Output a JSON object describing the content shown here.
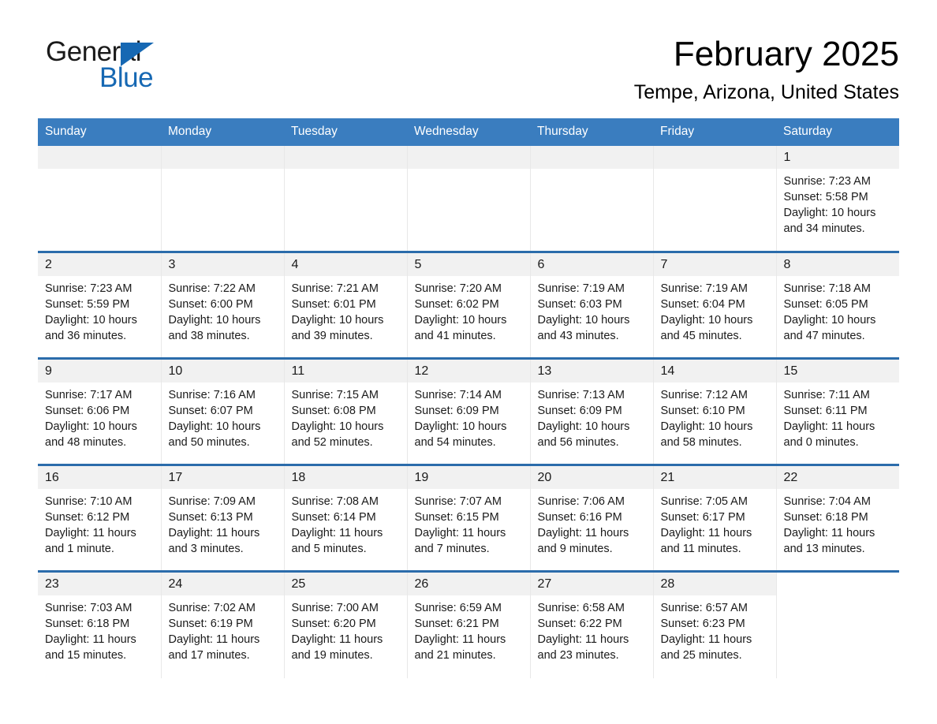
{
  "brand": {
    "name_part1": "General",
    "name_part2": "Blue",
    "accent_color": "#1668b3"
  },
  "header": {
    "title": "February 2025",
    "location": "Tempe, Arizona, United States"
  },
  "theme": {
    "header_blue": "#3a7dbf",
    "row_border_blue": "#2b6cab",
    "daynum_band": "#f1f1f1"
  },
  "weekdays": [
    "Sunday",
    "Monday",
    "Tuesday",
    "Wednesday",
    "Thursday",
    "Friday",
    "Saturday"
  ],
  "weeks": [
    [
      {
        "day": "",
        "lines": []
      },
      {
        "day": "",
        "lines": []
      },
      {
        "day": "",
        "lines": []
      },
      {
        "day": "",
        "lines": []
      },
      {
        "day": "",
        "lines": []
      },
      {
        "day": "",
        "lines": []
      },
      {
        "day": "1",
        "lines": [
          "Sunrise: 7:23 AM",
          "Sunset: 5:58 PM",
          "Daylight: 10 hours",
          "and 34 minutes."
        ]
      }
    ],
    [
      {
        "day": "2",
        "lines": [
          "Sunrise: 7:23 AM",
          "Sunset: 5:59 PM",
          "Daylight: 10 hours",
          "and 36 minutes."
        ]
      },
      {
        "day": "3",
        "lines": [
          "Sunrise: 7:22 AM",
          "Sunset: 6:00 PM",
          "Daylight: 10 hours",
          "and 38 minutes."
        ]
      },
      {
        "day": "4",
        "lines": [
          "Sunrise: 7:21 AM",
          "Sunset: 6:01 PM",
          "Daylight: 10 hours",
          "and 39 minutes."
        ]
      },
      {
        "day": "5",
        "lines": [
          "Sunrise: 7:20 AM",
          "Sunset: 6:02 PM",
          "Daylight: 10 hours",
          "and 41 minutes."
        ]
      },
      {
        "day": "6",
        "lines": [
          "Sunrise: 7:19 AM",
          "Sunset: 6:03 PM",
          "Daylight: 10 hours",
          "and 43 minutes."
        ]
      },
      {
        "day": "7",
        "lines": [
          "Sunrise: 7:19 AM",
          "Sunset: 6:04 PM",
          "Daylight: 10 hours",
          "and 45 minutes."
        ]
      },
      {
        "day": "8",
        "lines": [
          "Sunrise: 7:18 AM",
          "Sunset: 6:05 PM",
          "Daylight: 10 hours",
          "and 47 minutes."
        ]
      }
    ],
    [
      {
        "day": "9",
        "lines": [
          "Sunrise: 7:17 AM",
          "Sunset: 6:06 PM",
          "Daylight: 10 hours",
          "and 48 minutes."
        ]
      },
      {
        "day": "10",
        "lines": [
          "Sunrise: 7:16 AM",
          "Sunset: 6:07 PM",
          "Daylight: 10 hours",
          "and 50 minutes."
        ]
      },
      {
        "day": "11",
        "lines": [
          "Sunrise: 7:15 AM",
          "Sunset: 6:08 PM",
          "Daylight: 10 hours",
          "and 52 minutes."
        ]
      },
      {
        "day": "12",
        "lines": [
          "Sunrise: 7:14 AM",
          "Sunset: 6:09 PM",
          "Daylight: 10 hours",
          "and 54 minutes."
        ]
      },
      {
        "day": "13",
        "lines": [
          "Sunrise: 7:13 AM",
          "Sunset: 6:09 PM",
          "Daylight: 10 hours",
          "and 56 minutes."
        ]
      },
      {
        "day": "14",
        "lines": [
          "Sunrise: 7:12 AM",
          "Sunset: 6:10 PM",
          "Daylight: 10 hours",
          "and 58 minutes."
        ]
      },
      {
        "day": "15",
        "lines": [
          "Sunrise: 7:11 AM",
          "Sunset: 6:11 PM",
          "Daylight: 11 hours",
          "and 0 minutes."
        ]
      }
    ],
    [
      {
        "day": "16",
        "lines": [
          "Sunrise: 7:10 AM",
          "Sunset: 6:12 PM",
          "Daylight: 11 hours",
          "and 1 minute."
        ]
      },
      {
        "day": "17",
        "lines": [
          "Sunrise: 7:09 AM",
          "Sunset: 6:13 PM",
          "Daylight: 11 hours",
          "and 3 minutes."
        ]
      },
      {
        "day": "18",
        "lines": [
          "Sunrise: 7:08 AM",
          "Sunset: 6:14 PM",
          "Daylight: 11 hours",
          "and 5 minutes."
        ]
      },
      {
        "day": "19",
        "lines": [
          "Sunrise: 7:07 AM",
          "Sunset: 6:15 PM",
          "Daylight: 11 hours",
          "and 7 minutes."
        ]
      },
      {
        "day": "20",
        "lines": [
          "Sunrise: 7:06 AM",
          "Sunset: 6:16 PM",
          "Daylight: 11 hours",
          "and 9 minutes."
        ]
      },
      {
        "day": "21",
        "lines": [
          "Sunrise: 7:05 AM",
          "Sunset: 6:17 PM",
          "Daylight: 11 hours",
          "and 11 minutes."
        ]
      },
      {
        "day": "22",
        "lines": [
          "Sunrise: 7:04 AM",
          "Sunset: 6:18 PM",
          "Daylight: 11 hours",
          "and 13 minutes."
        ]
      }
    ],
    [
      {
        "day": "23",
        "lines": [
          "Sunrise: 7:03 AM",
          "Sunset: 6:18 PM",
          "Daylight: 11 hours",
          "and 15 minutes."
        ]
      },
      {
        "day": "24",
        "lines": [
          "Sunrise: 7:02 AM",
          "Sunset: 6:19 PM",
          "Daylight: 11 hours",
          "and 17 minutes."
        ]
      },
      {
        "day": "25",
        "lines": [
          "Sunrise: 7:00 AM",
          "Sunset: 6:20 PM",
          "Daylight: 11 hours",
          "and 19 minutes."
        ]
      },
      {
        "day": "26",
        "lines": [
          "Sunrise: 6:59 AM",
          "Sunset: 6:21 PM",
          "Daylight: 11 hours",
          "and 21 minutes."
        ]
      },
      {
        "day": "27",
        "lines": [
          "Sunrise: 6:58 AM",
          "Sunset: 6:22 PM",
          "Daylight: 11 hours",
          "and 23 minutes."
        ]
      },
      {
        "day": "28",
        "lines": [
          "Sunrise: 6:57 AM",
          "Sunset: 6:23 PM",
          "Daylight: 11 hours",
          "and 25 minutes."
        ]
      },
      {
        "day": "",
        "lines": []
      }
    ]
  ]
}
